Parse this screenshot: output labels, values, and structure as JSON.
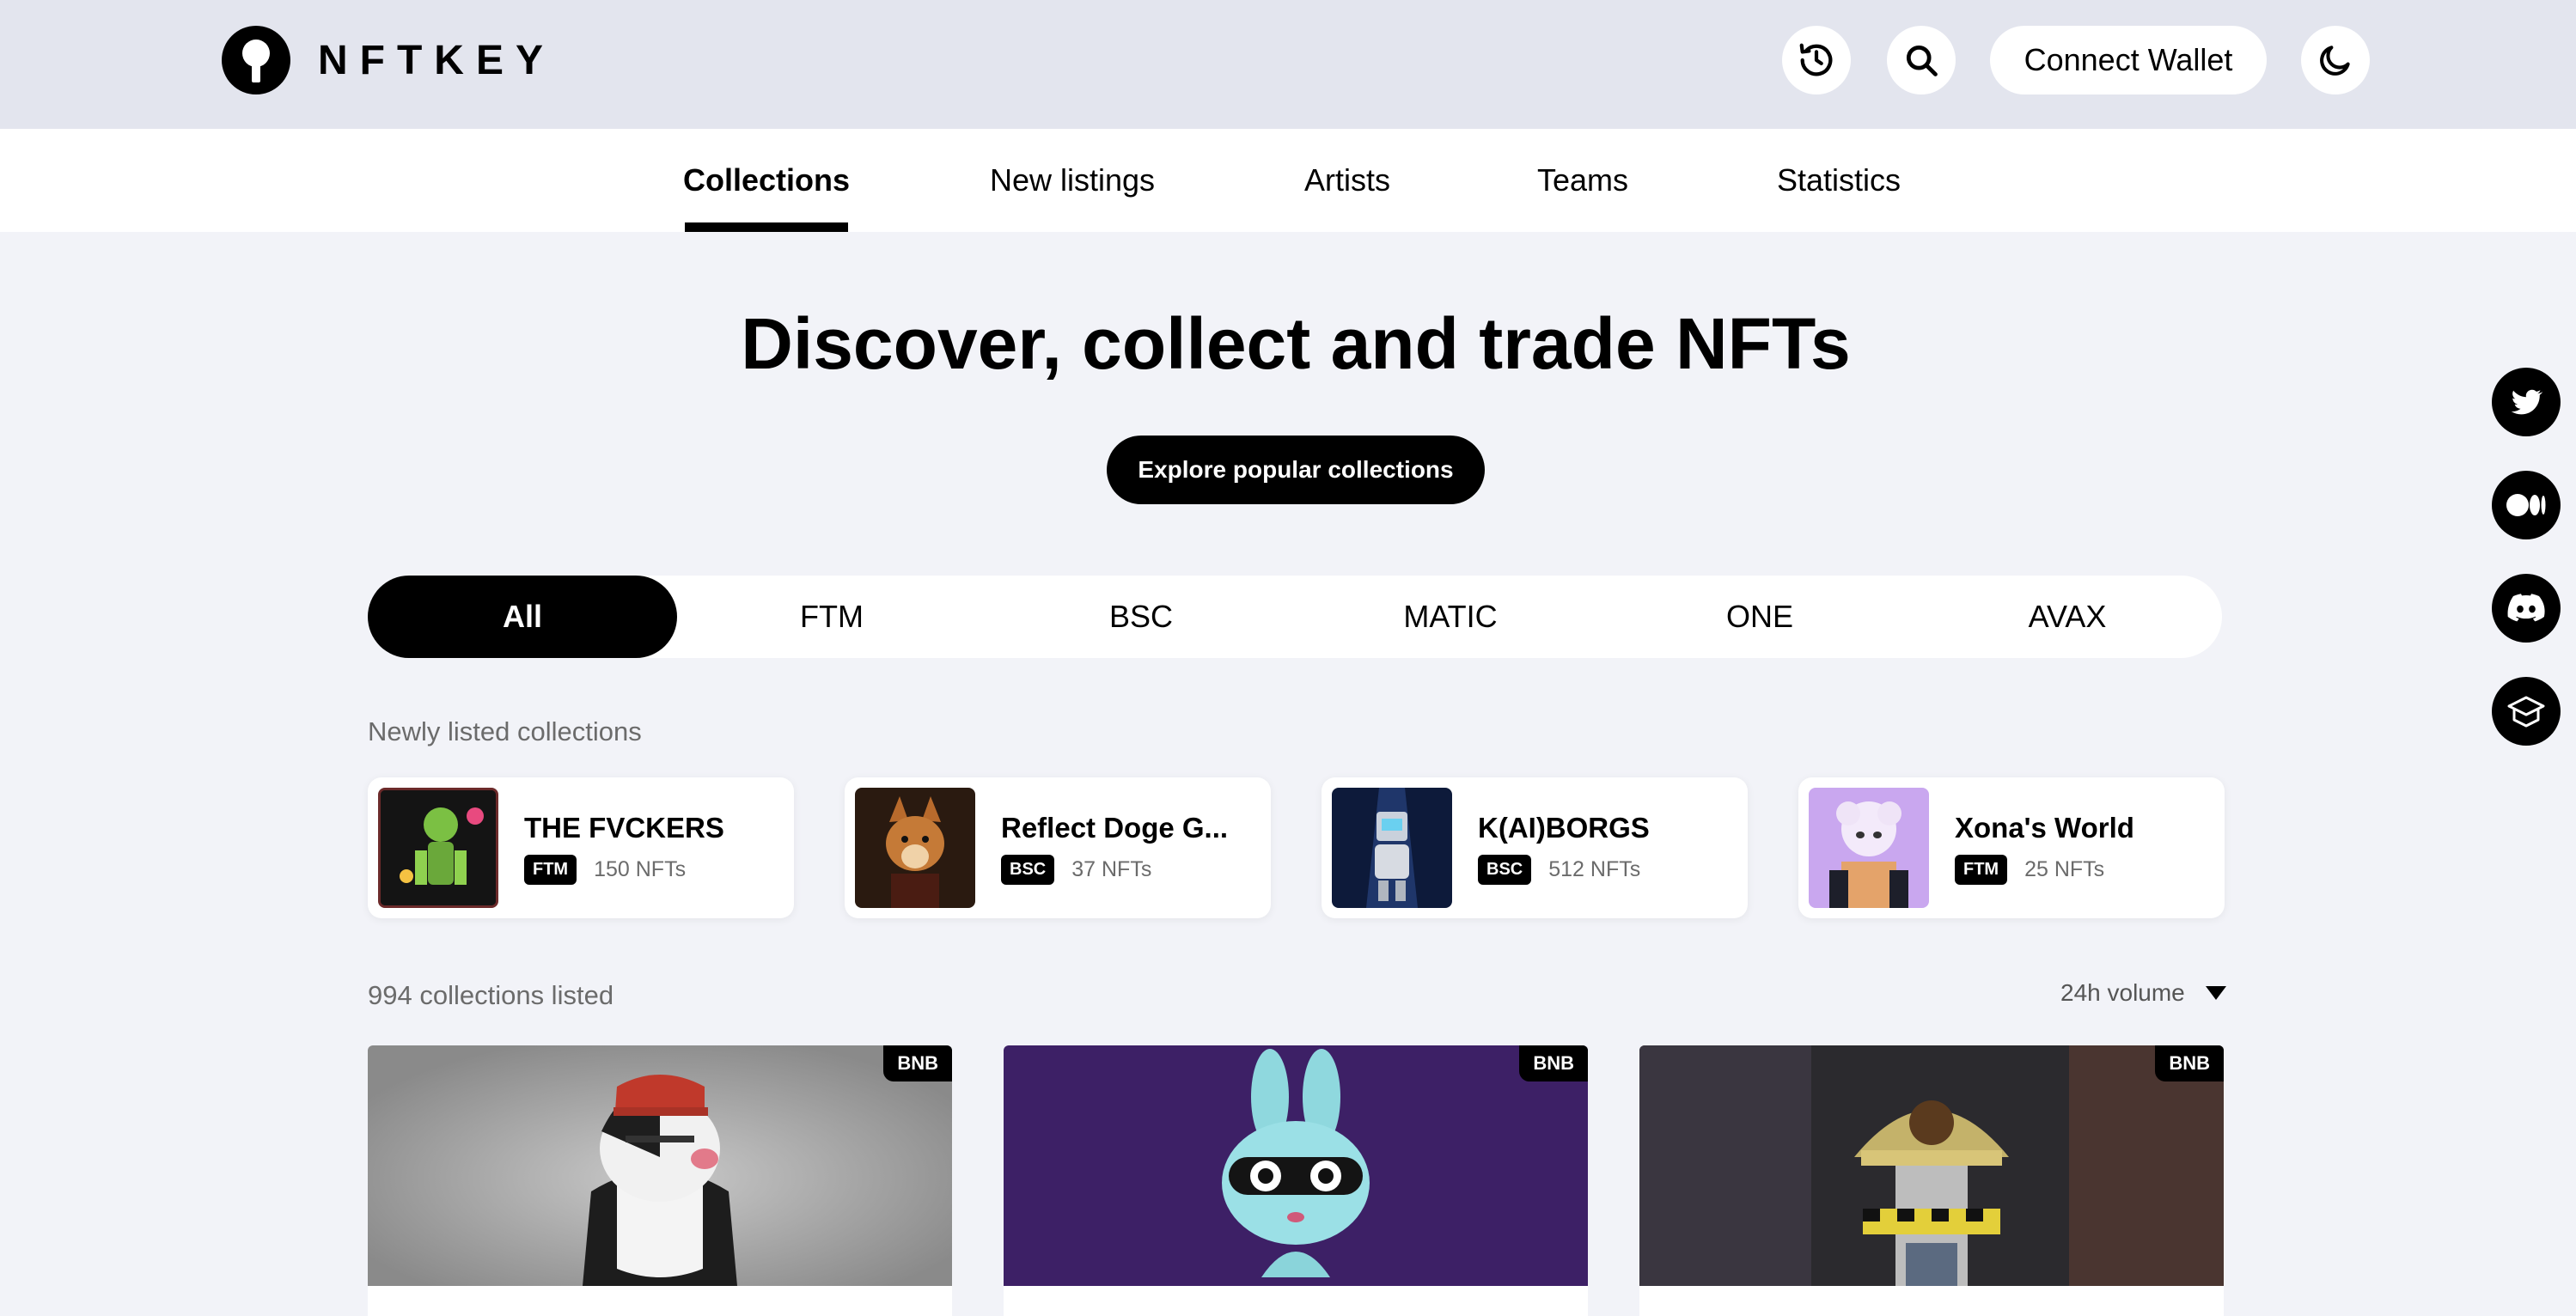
{
  "brand": {
    "name": "NFTKEY"
  },
  "header": {
    "history_icon": "history-icon",
    "search_icon": "search-icon",
    "connect_label": "Connect Wallet",
    "theme_icon": "moon-icon"
  },
  "tabs": [
    {
      "label": "Collections",
      "active": true
    },
    {
      "label": "New listings"
    },
    {
      "label": "Artists"
    },
    {
      "label": "Teams"
    },
    {
      "label": "Statistics"
    }
  ],
  "hero": {
    "title": "Discover, collect and trade NFTs",
    "cta": "Explore popular collections"
  },
  "chains": [
    {
      "label": "All",
      "active": true
    },
    {
      "label": "FTM"
    },
    {
      "label": "BSC"
    },
    {
      "label": "MATIC"
    },
    {
      "label": "ONE"
    },
    {
      "label": "AVAX"
    }
  ],
  "newly_listed": {
    "heading": "Newly listed collections",
    "items": [
      {
        "name": "THE FVCKERS",
        "chain": "FTM",
        "count": "150 NFTs"
      },
      {
        "name": "Reflect Doge G...",
        "chain": "BSC",
        "count": "37 NFTs"
      },
      {
        "name": "K(AI)BORGS",
        "chain": "BSC",
        "count": "512 NFTs"
      },
      {
        "name": "Xona's World",
        "chain": "FTM",
        "count": "25 NFTs"
      }
    ]
  },
  "collections": {
    "count_label": "994 collections listed",
    "sort_label": "24h volume",
    "cards": [
      {
        "badge": "BNB"
      },
      {
        "badge": "BNB"
      },
      {
        "badge": "BNB"
      }
    ]
  },
  "social": [
    "twitter-icon",
    "medium-icon",
    "discord-icon",
    "docs-icon"
  ],
  "colors": {
    "accent": "#000000",
    "header_bg": "#e3e5ee",
    "page_bg": "#f2f3f8"
  }
}
